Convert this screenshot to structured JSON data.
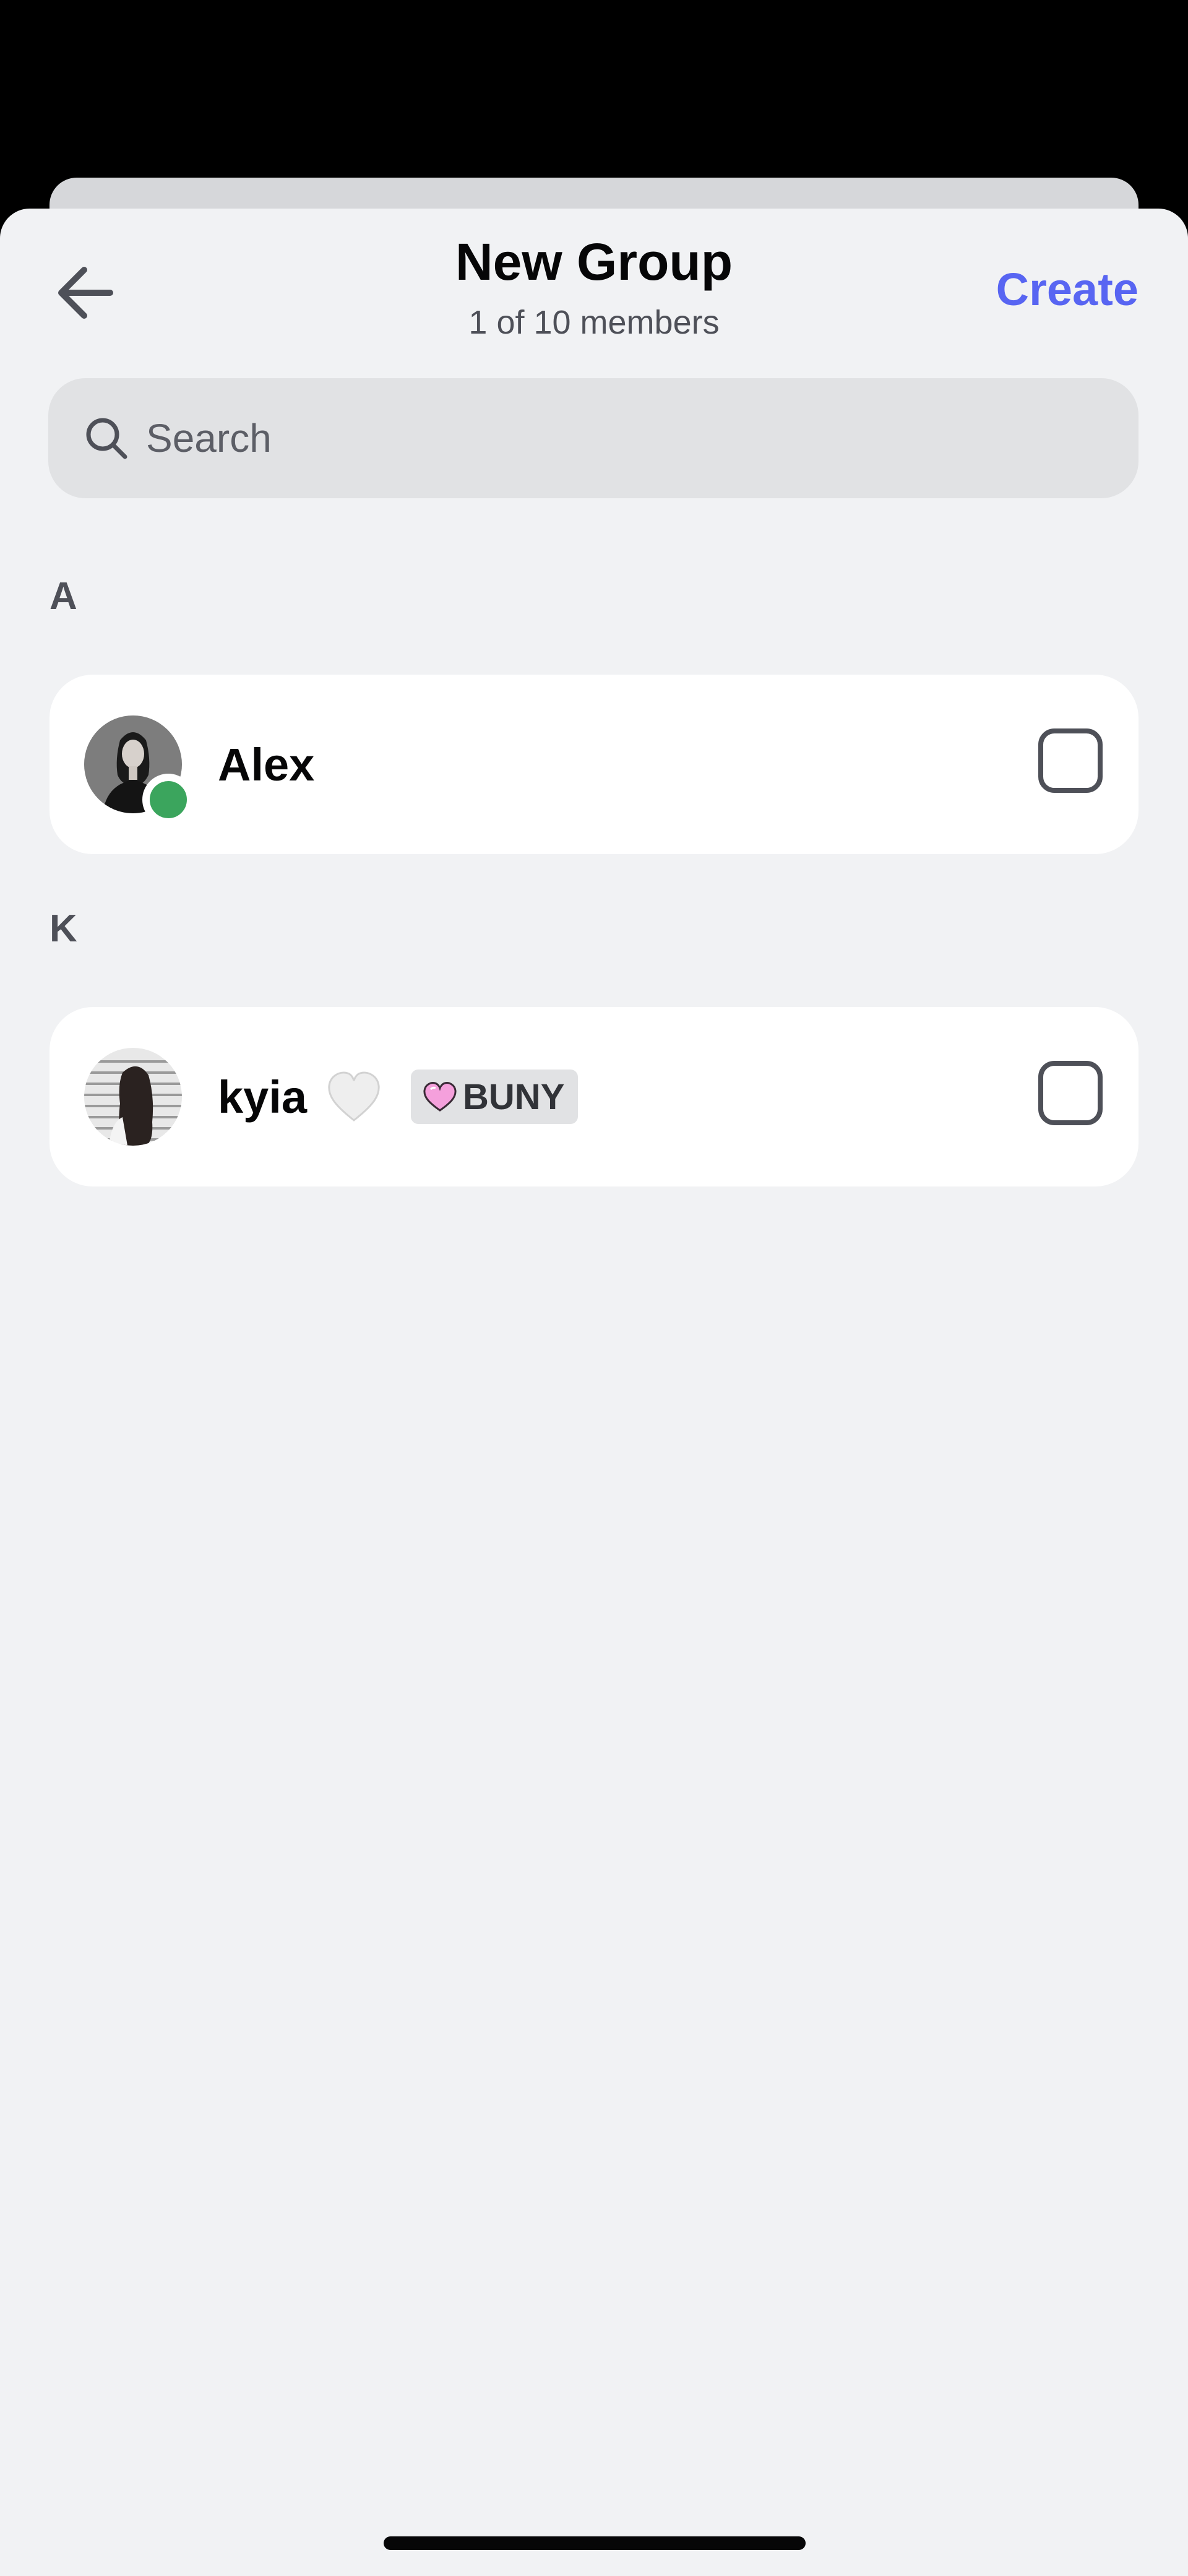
{
  "header": {
    "title": "New Group",
    "subtitle": "1 of 10 members",
    "create_label": "Create"
  },
  "search": {
    "placeholder": "Search"
  },
  "sections": [
    {
      "letter": "A",
      "friends": [
        {
          "name": "Alex",
          "status": "online",
          "selected": false
        }
      ]
    },
    {
      "letter": "K",
      "friends": [
        {
          "name": "kyia",
          "emoji": "white-heart",
          "tag": "BUNY",
          "tag_icon": "pink-heart-icon",
          "selected": false
        }
      ]
    }
  ],
  "colors": {
    "accent": "#5865f2",
    "online": "#3ba55d",
    "background": "#f1f2f4"
  }
}
